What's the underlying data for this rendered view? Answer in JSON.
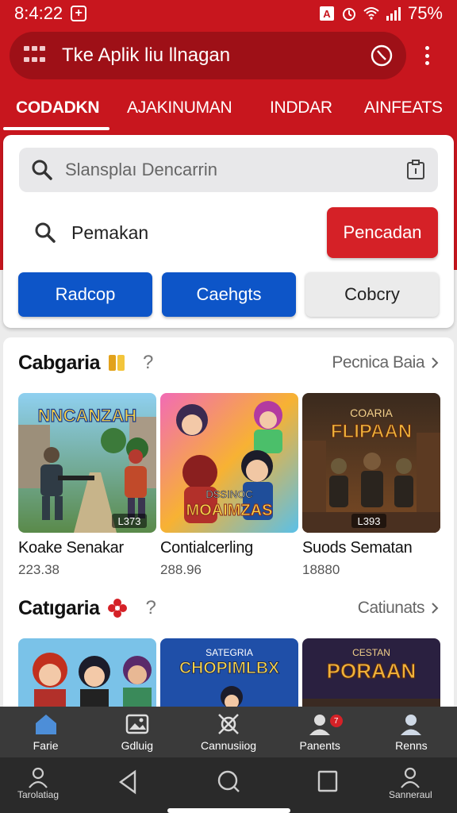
{
  "status_bar": {
    "time": "8:4:22",
    "battery": "75%",
    "icons": [
      "plus-box-icon",
      "a-icon",
      "alarm-icon",
      "wifi-icon",
      "signal-icon"
    ]
  },
  "app_bar": {
    "title": "Tke Aplik liu llnagan",
    "icons": [
      "apps-grid-icon",
      "clock-icon",
      "more-vert-icon"
    ]
  },
  "tabs": [
    {
      "label": "CODADKN",
      "active": true
    },
    {
      "label": "AJAKINUMAN",
      "active": false
    },
    {
      "label": "INDDAR",
      "active": false
    },
    {
      "label": "AINFEATS",
      "active": false
    }
  ],
  "search": {
    "placeholder": "Slansplaı Dencarrin",
    "query_label": "Pemakan",
    "search_button": "Pencadan",
    "filters": [
      {
        "label": "Radcop",
        "style": "primary"
      },
      {
        "label": "Caehgts",
        "style": "primary"
      },
      {
        "label": "Cobcry",
        "style": "secondary"
      }
    ]
  },
  "sections": [
    {
      "title": "Cabgaria",
      "see_all": "Pecnica Baia",
      "games": [
        {
          "name": "Koake Senakar",
          "count": "223.38",
          "art_title": "NNCANZAH",
          "badge": "L373"
        },
        {
          "name": "Contialcerling",
          "count": "288.96",
          "art_title": "MOAIMZAS",
          "art_subtitle": "DSSINOC"
        },
        {
          "name": "Suods Sematan",
          "count": "18880",
          "art_title": "FLIPAAN",
          "art_subtitle": "COARIA",
          "badge": "L393"
        }
      ]
    },
    {
      "title": "Catıgaria",
      "see_all": "Catiunats",
      "games": [
        {
          "name": "",
          "count": "",
          "art_title": ""
        },
        {
          "name": "",
          "count": "",
          "art_title": "CHOPIMLBX",
          "art_subtitle": "SATEGRIA"
        },
        {
          "name": "",
          "count": "",
          "art_title": "PORAAN",
          "art_subtitle": "CESTAN"
        }
      ]
    }
  ],
  "bottom_nav": [
    {
      "label": "Farie",
      "icon": "home-icon",
      "active": true
    },
    {
      "label": "Gdluig",
      "icon": "gallery-icon",
      "active": false
    },
    {
      "label": "Cannusiiog",
      "icon": "satellite-icon",
      "active": false
    },
    {
      "label": "Panents",
      "icon": "profile-notification-icon",
      "active": false,
      "badge": "7"
    },
    {
      "label": "Renns",
      "icon": "person-icon",
      "active": false
    }
  ],
  "system_nav": {
    "left_label": "Tarolatiag",
    "right_label": "Sanneraul"
  },
  "colors": {
    "brand_red": "#c8161e",
    "appbar_red": "#9e1017",
    "button_red": "#d52127",
    "button_blue": "#0d55c8"
  }
}
